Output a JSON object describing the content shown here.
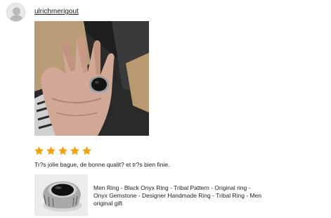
{
  "review": {
    "username": "ulrichmerigout",
    "rating": 5,
    "rating_max": 5,
    "text": "Tr?s jolie bague, de bonne qualit? et tr?s bien finie.",
    "star_color": "#F1A10D"
  },
  "product": {
    "title": "Men Ring - Black Onyx Ring - Tribal Pattern - Original ring - Onyx Gemstone - Designer Handmade Ring - Tribal Ring - Men original gift"
  },
  "icons": {
    "avatar": "user-avatar-icon",
    "star": "star-icon"
  }
}
